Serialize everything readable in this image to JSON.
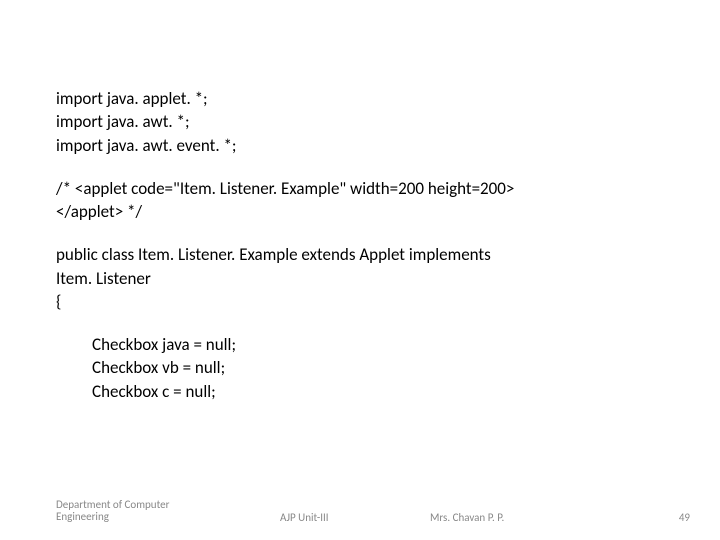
{
  "code": {
    "l1": "import java. applet. *;",
    "l2": "import java. awt. *;",
    "l3": "import java. awt. event. *;",
    "l4": " /* <applet code=\"Item. Listener. Example\" width=200 height=200>",
    "l5": "</applet> */",
    "l6": "public class Item. Listener. Example extends Applet implements",
    "l7": "Item. Listener",
    "l8": "{",
    "l9": "Checkbox java = null;",
    "l10": "Checkbox vb = null;",
    "l11": "Checkbox c = null;"
  },
  "footer": {
    "dept": "Department of Computer Engineering",
    "mid": "AJP Unit-III",
    "auth": "Mrs. Chavan P. P.",
    "page": "49"
  }
}
